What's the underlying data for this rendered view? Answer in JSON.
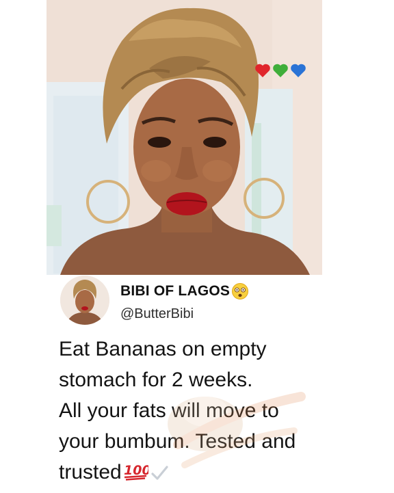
{
  "post": {
    "hearts_emojis": [
      "red-heart",
      "green-heart",
      "blue-heart"
    ],
    "author": {
      "display_name": "BIBI OF LAGOS",
      "name_emoji": "dizzy-face",
      "handle": "@ButterBibi"
    },
    "text_lines": [
      "Eat Bananas on empty",
      "stomach for 2 weeks.",
      "All your fats will move to",
      "your bumbum. Tested and",
      "trusted"
    ],
    "trailing_emojis": [
      "hundred-points",
      "check-mark"
    ]
  },
  "colors": {
    "heart_red": "#e0252b",
    "heart_green": "#3fae3a",
    "heart_blue": "#2a73d6",
    "headwrap": "#b48a52",
    "lips": "#b2141d"
  }
}
